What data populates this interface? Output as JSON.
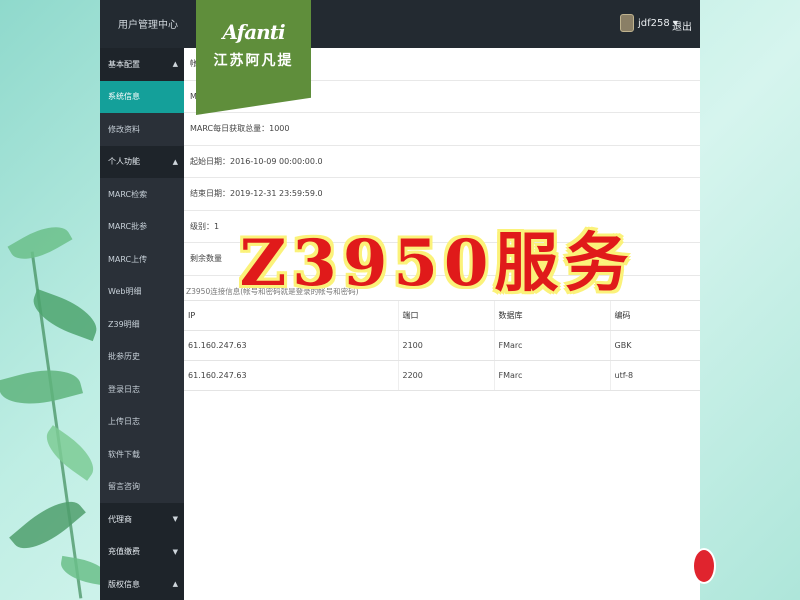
{
  "header": {
    "title": "用户管理中心",
    "user": "jdf258 ▾",
    "logout": "退出"
  },
  "logo": {
    "brand": "Afanti",
    "brand_cn": "江苏阿凡提"
  },
  "overlay_title": "Z3950服务",
  "sidebar": {
    "items": [
      {
        "label": "基本配置",
        "type": "group",
        "caret": "▲"
      },
      {
        "label": "系统信息",
        "type": "active"
      },
      {
        "label": "修改资料",
        "type": "item"
      },
      {
        "label": "个人功能",
        "type": "group",
        "caret": "▲"
      },
      {
        "label": "MARC检索",
        "type": "item"
      },
      {
        "label": "MARC批参",
        "type": "item"
      },
      {
        "label": "MARC上传",
        "type": "item"
      },
      {
        "label": "Web明细",
        "type": "item"
      },
      {
        "label": "Z39明细",
        "type": "item"
      },
      {
        "label": "批参历史",
        "type": "item"
      },
      {
        "label": "登录日志",
        "type": "item"
      },
      {
        "label": "上传日志",
        "type": "item"
      },
      {
        "label": "软件下载",
        "type": "item"
      },
      {
        "label": "留言咨询",
        "type": "item"
      },
      {
        "label": "代理商",
        "type": "group",
        "caret": "▼"
      },
      {
        "label": "充值缴费",
        "type": "group",
        "caret": "▼"
      },
      {
        "label": "版权信息",
        "type": "group",
        "caret": "▲"
      }
    ]
  },
  "info": {
    "rows": [
      "帐号",
      "MARC数据量：34584",
      "MARC每日获取总量：1000",
      "起始日期：2016-10-09 00:00:00.0",
      "结束日期：2019-12-31 23:59:59.0",
      "级别：1",
      "剩余数量"
    ]
  },
  "z3950": {
    "section_label": "Z3950连接信息(帐号和密码就是登录的帐号和密码)",
    "columns": [
      "IP",
      "端口",
      "数据库",
      "编码"
    ],
    "rows": [
      [
        "61.160.247.63",
        "2100",
        "FMarc",
        "GBK"
      ],
      [
        "61.160.247.63",
        "2200",
        "FMarc",
        "utf-8"
      ]
    ]
  },
  "colors": {
    "topbar": "#232a31",
    "sidebar": "#2a3038",
    "active": "#14a09a",
    "logo_green": "#5f8e3b",
    "title_red": "#e01a1a",
    "title_outline": "#fbf27a"
  }
}
